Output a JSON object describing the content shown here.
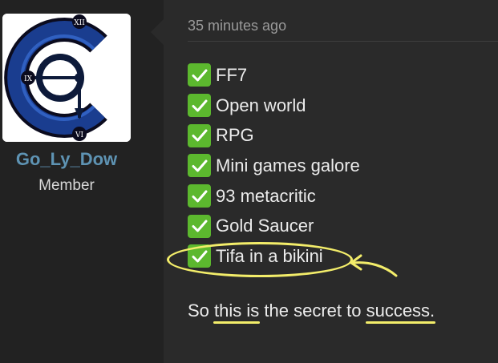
{
  "user": {
    "name": "Go_Ly_Dow",
    "role": "Member",
    "avatar_icon": "clock-c-logo-icon",
    "accent_color": "#5e93b3"
  },
  "message": {
    "timestamp": "35 minutes ago",
    "checklist": [
      {
        "icon": "check-mark-icon",
        "text": "FF7"
      },
      {
        "icon": "check-mark-icon",
        "text": "Open world"
      },
      {
        "icon": "check-mark-icon",
        "text": "RPG"
      },
      {
        "icon": "check-mark-icon",
        "text": "Mini games galore"
      },
      {
        "icon": "check-mark-icon",
        "text": "93 metacritic"
      },
      {
        "icon": "check-mark-icon",
        "text": "Gold Saucer"
      },
      {
        "icon": "check-mark-icon",
        "text": "Tifa in a bikini",
        "circled": true
      }
    ],
    "caption": {
      "before": "So ",
      "highlight1": "this is",
      "middle": " the secret to ",
      "highlight2": "success.",
      "after": ""
    }
  },
  "colors": {
    "check_green": "#5cb82e",
    "annotation_yellow": "#f3ed6a",
    "background": "#2a2a2a",
    "sidebar": "#222222"
  }
}
